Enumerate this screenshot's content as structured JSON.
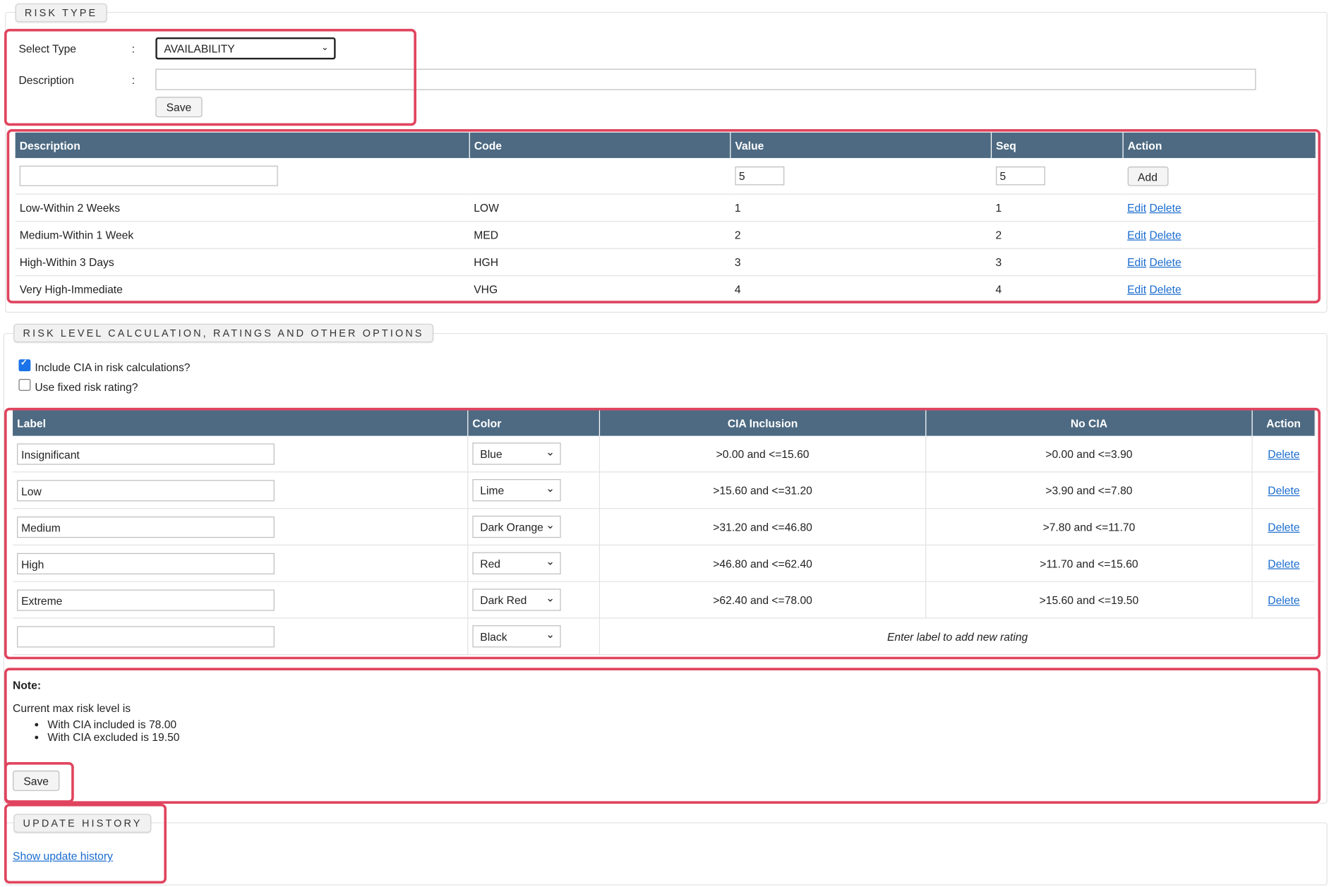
{
  "risk_type": {
    "legend": "RISK TYPE",
    "select_type_label": "Select Type",
    "select_type_value": "AVAILABILITY",
    "description_label": "Description",
    "colon": ":",
    "save_label": "Save"
  },
  "type_table": {
    "headers": [
      "Description",
      "Code",
      "Value",
      "Seq",
      "Action"
    ],
    "new_value": "5",
    "new_seq": "5",
    "add_label": "Add",
    "rows": [
      {
        "description": "Low-Within 2 Weeks",
        "code": "LOW",
        "value": "1",
        "seq": "1"
      },
      {
        "description": "Medium-Within 1 Week",
        "code": "MED",
        "value": "2",
        "seq": "2"
      },
      {
        "description": "High-Within 3 Days",
        "code": "HGH",
        "value": "3",
        "seq": "3"
      },
      {
        "description": "Very High-Immediate",
        "code": "VHG",
        "value": "4",
        "seq": "4"
      }
    ],
    "edit_label": "Edit",
    "delete_label": "Delete"
  },
  "risk_level": {
    "legend": "RISK LEVEL CALCULATION, RATINGS AND OTHER OPTIONS",
    "include_cia_label": "Include CIA in risk calculations?",
    "include_cia_checked": true,
    "fixed_rating_label": "Use fixed risk rating?",
    "fixed_rating_checked": false
  },
  "rating_table": {
    "headers": [
      "Label",
      "Color",
      "CIA Inclusion",
      "No CIA",
      "Action"
    ],
    "rows": [
      {
        "label": "Insignificant",
        "color": "Blue",
        "cia": ">0.00 and <=15.60",
        "no_cia": ">0.00 and <=3.90"
      },
      {
        "label": "Low",
        "color": "Lime",
        "cia": ">15.60 and <=31.20",
        "no_cia": ">3.90 and <=7.80"
      },
      {
        "label": "Medium",
        "color": "Dark Orange",
        "cia": ">31.20 and <=46.80",
        "no_cia": ">7.80 and <=11.70"
      },
      {
        "label": "High",
        "color": "Red",
        "cia": ">46.80 and <=62.40",
        "no_cia": ">11.70 and <=15.60"
      },
      {
        "label": "Extreme",
        "color": "Dark Red",
        "cia": ">62.40 and <=78.00",
        "no_cia": ">15.60 and <=19.50"
      }
    ],
    "delete_label": "Delete",
    "new_color": "Black",
    "new_hint": "Enter label to add new rating"
  },
  "note": {
    "title": "Note:",
    "intro": "Current max risk level is",
    "items": [
      "With CIA included is 78.00",
      "With CIA excluded is 19.50"
    ],
    "save_label": "Save"
  },
  "history": {
    "legend": "UPDATE HISTORY",
    "link": "Show update history"
  }
}
